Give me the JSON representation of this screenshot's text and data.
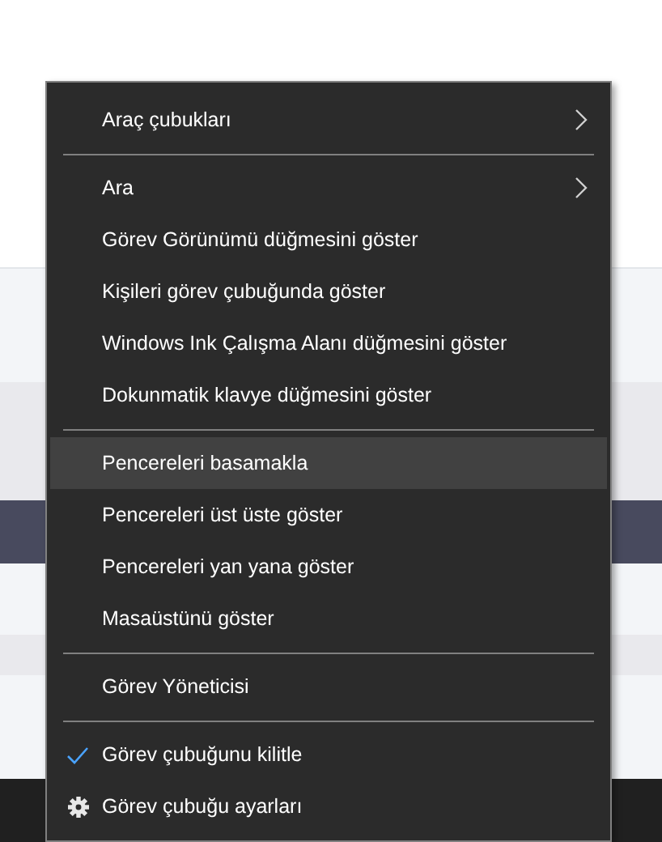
{
  "context_menu": {
    "sections": [
      [
        {
          "label": "Araç çubukları",
          "kind": "submenu",
          "highlighted": false
        }
      ],
      [
        {
          "label": "Ara",
          "kind": "submenu",
          "highlighted": false
        },
        {
          "label": "Görev Görünümü düğmesini göster",
          "kind": "command",
          "highlighted": false
        },
        {
          "label": "Kişileri görev çubuğunda göster",
          "kind": "command",
          "highlighted": false
        },
        {
          "label": "Windows Ink Çalışma Alanı düğmesini göster",
          "kind": "command",
          "highlighted": false
        },
        {
          "label": "Dokunmatik klavye düğmesini göster",
          "kind": "command",
          "highlighted": false
        }
      ],
      [
        {
          "label": "Pencereleri basamakla",
          "kind": "command",
          "highlighted": true
        },
        {
          "label": "Pencereleri üst üste göster",
          "kind": "command",
          "highlighted": false
        },
        {
          "label": "Pencereleri yan yana göster",
          "kind": "command",
          "highlighted": false
        },
        {
          "label": "Masaüstünü göster",
          "kind": "command",
          "highlighted": false
        }
      ],
      [
        {
          "label": "Görev Yöneticisi",
          "kind": "command",
          "highlighted": false
        }
      ],
      [
        {
          "label": "Görev çubuğunu kilitle",
          "kind": "toggle",
          "checked": true,
          "highlighted": false
        },
        {
          "label": "Görev çubuğu ayarları",
          "kind": "settings",
          "highlighted": false
        }
      ]
    ]
  }
}
